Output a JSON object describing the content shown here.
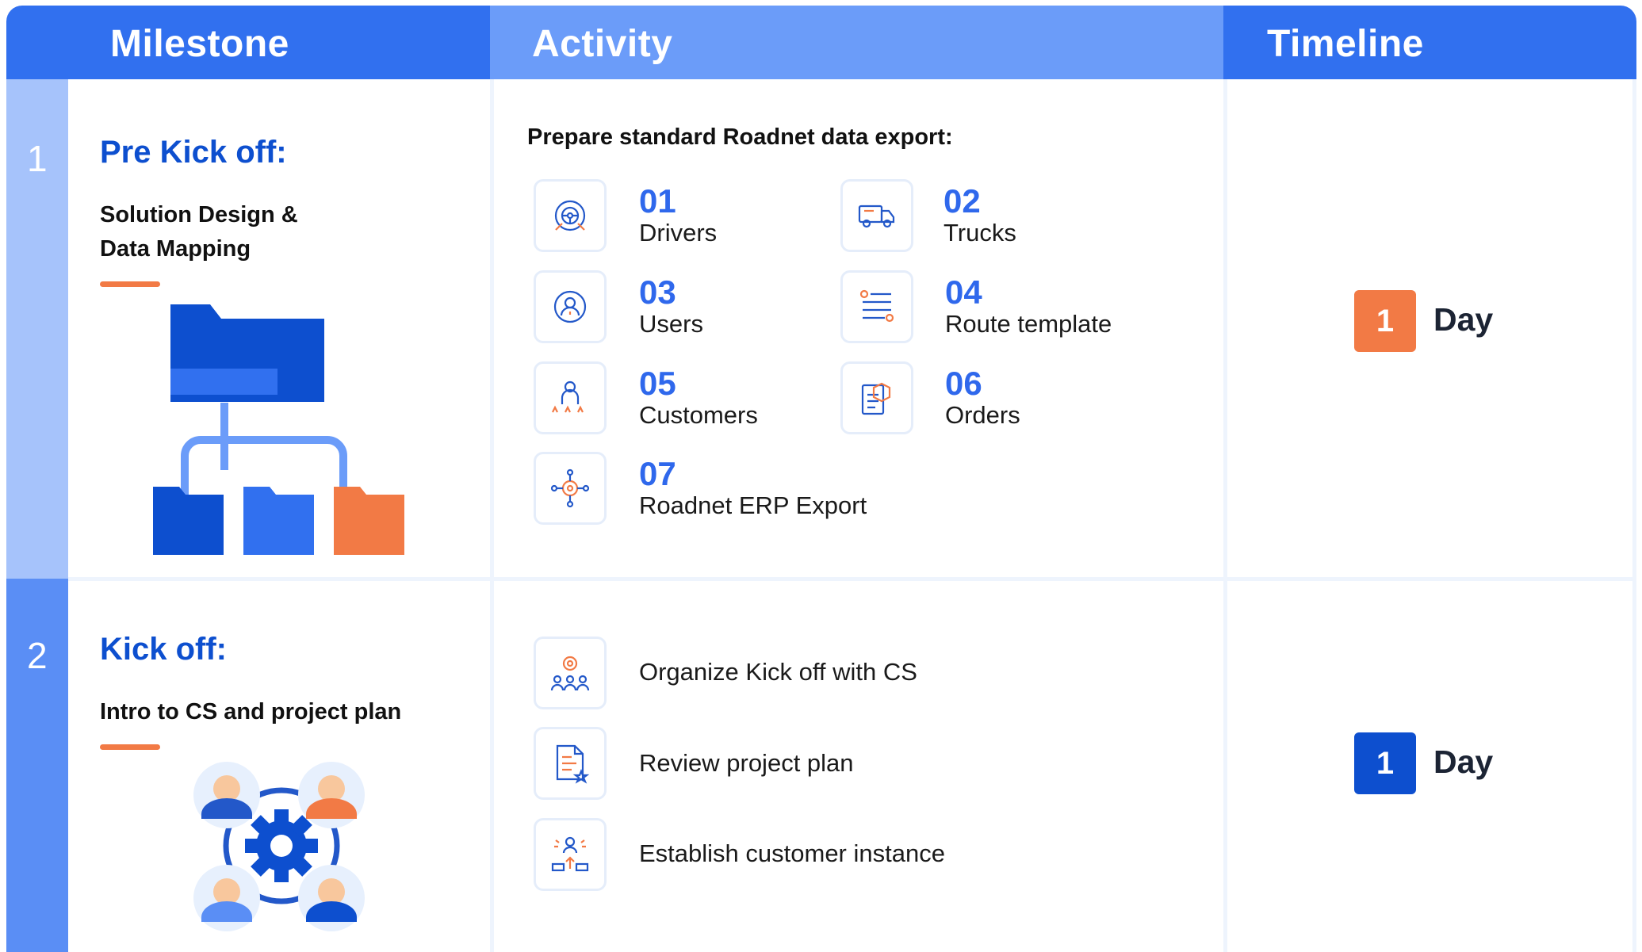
{
  "header": {
    "milestone": "Milestone",
    "activity": "Activity",
    "timeline": "Timeline"
  },
  "colors": {
    "primary": "#3170ef",
    "header_activity": "#6b9cf9",
    "accent_orange": "#f27a45",
    "dark_blue": "#0d4fcf"
  },
  "rows": [
    {
      "number": "1",
      "title": "Pre Kick off:",
      "subtitle_line1": "Solution Design &",
      "subtitle_line2": "Data Mapping",
      "illustration": "folder-hierarchy-icon",
      "activity_title": "Prepare standard Roadnet data export:",
      "items": [
        {
          "num": "01",
          "label": "Drivers",
          "icon": "steering-driver-icon"
        },
        {
          "num": "02",
          "label": "Trucks",
          "icon": "truck-icon"
        },
        {
          "num": "03",
          "label": "Users",
          "icon": "user-circle-icon"
        },
        {
          "num": "04",
          "label": "Route template",
          "icon": "route-icon"
        },
        {
          "num": "05",
          "label": "Customers",
          "icon": "customer-rating-icon"
        },
        {
          "num": "06",
          "label": "Orders",
          "icon": "order-clipboard-icon"
        },
        {
          "num": "07",
          "label": "Roadnet ERP Export",
          "icon": "gear-network-icon"
        }
      ],
      "timeline": {
        "value": "1",
        "unit": "Day",
        "badge_color": "#f27a45"
      }
    },
    {
      "number": "2",
      "title": "Kick off:",
      "subtitle": "Intro to CS and project plan",
      "illustration": "team-gear-icon",
      "items": [
        {
          "label": "Organize Kick off with CS",
          "icon": "team-settings-icon"
        },
        {
          "label": "Review project plan",
          "icon": "document-star-icon"
        },
        {
          "label": "Establish customer instance",
          "icon": "upload-person-icon"
        }
      ],
      "timeline": {
        "value": "1",
        "unit": "Day",
        "badge_color": "#0d4fcf"
      }
    }
  ]
}
